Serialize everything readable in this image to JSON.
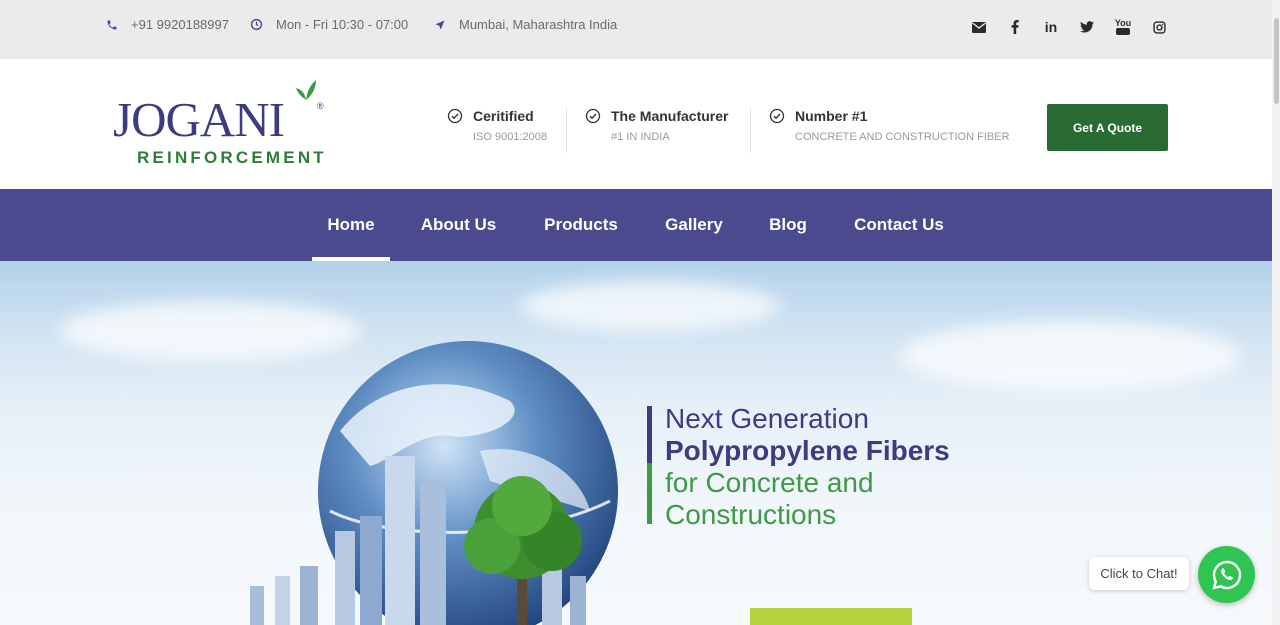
{
  "topbar": {
    "phone": "+91 9920188997",
    "hours": "Mon - Fri 10:30 - 07:00",
    "location": "Mumbai, Maharashtra India",
    "social": [
      "email-icon",
      "facebook-icon",
      "linkedin-icon",
      "twitter-icon",
      "youtube-icon",
      "instagram-icon"
    ]
  },
  "logo": {
    "main": "JOGANI",
    "sub": "REINFORCEMENT",
    "reg": "®"
  },
  "features": [
    {
      "title": "Ceritified",
      "subtitle": "ISO 9001:2008"
    },
    {
      "title": "The Manufacturer",
      "subtitle": "#1 IN INDIA"
    },
    {
      "title": "Number #1",
      "subtitle": "CONCRETE AND CONSTRUCTION FIBER"
    }
  ],
  "cta": {
    "quote_label": "Get A Quote"
  },
  "nav": {
    "items": [
      {
        "label": "Home",
        "active": true
      },
      {
        "label": "About Us",
        "active": false
      },
      {
        "label": "Products",
        "active": false
      },
      {
        "label": "Gallery",
        "active": false
      },
      {
        "label": "Blog",
        "active": false
      },
      {
        "label": "Contact Us",
        "active": false
      }
    ]
  },
  "hero": {
    "line1": "Next Generation",
    "line2": "Polypropylene Fibers",
    "line3": "for Concrete and",
    "line4": "Constructions"
  },
  "chat": {
    "label": "Click to Chat!"
  },
  "colors": {
    "brand_purple": "#4a4a8e",
    "brand_green": "#2a6b33",
    "whatsapp_green": "#30c452"
  }
}
